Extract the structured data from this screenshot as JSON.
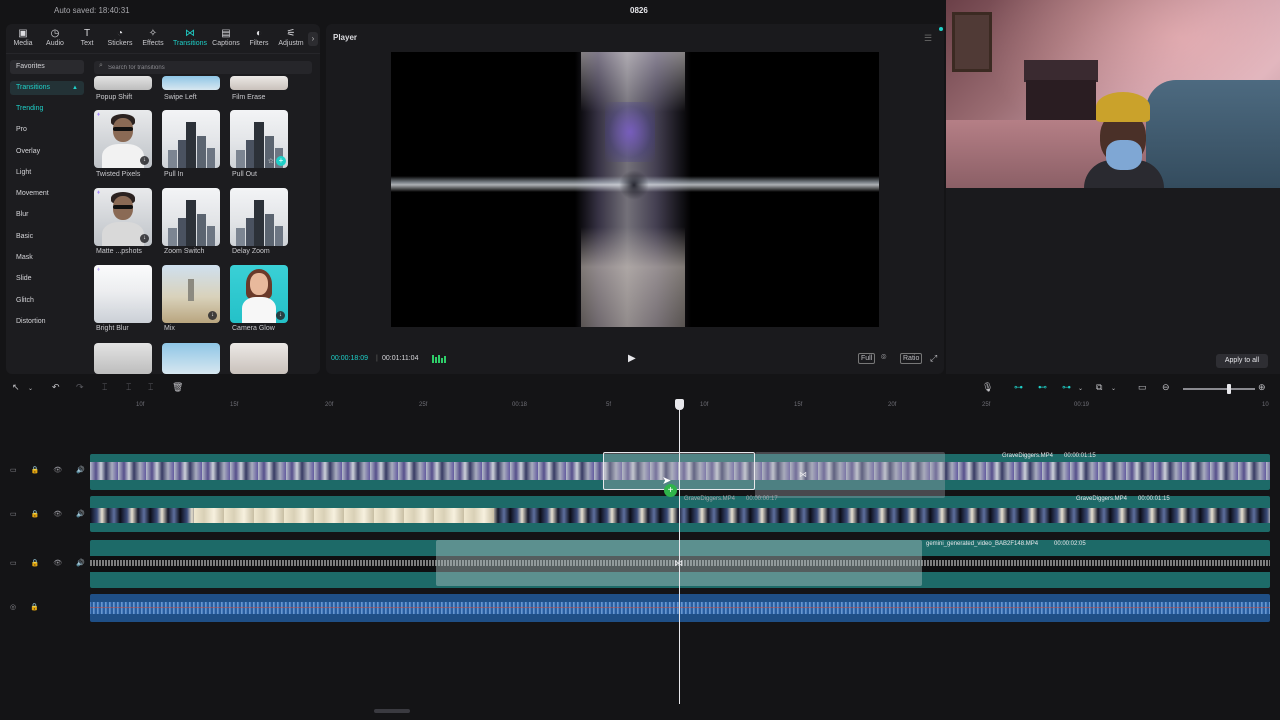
{
  "top_bar": {
    "autosave": "Auto saved: 18:40:31",
    "project_title": "0826"
  },
  "tools": [
    {
      "label": "Media",
      "icon": "media-icon"
    },
    {
      "label": "Audio",
      "icon": "audio-icon"
    },
    {
      "label": "Text",
      "icon": "text-icon"
    },
    {
      "label": "Stickers",
      "icon": "stickers-icon"
    },
    {
      "label": "Effects",
      "icon": "effects-icon"
    },
    {
      "label": "Transitions",
      "icon": "transitions-icon"
    },
    {
      "label": "Captions",
      "icon": "captions-icon"
    },
    {
      "label": "Filters",
      "icon": "filters-icon"
    },
    {
      "label": "Adjustm",
      "icon": "adjustment-icon"
    }
  ],
  "categories": {
    "favorites": "Favorites",
    "transitions": "Transitions",
    "items": [
      "Trending",
      "Pro",
      "Overlay",
      "Light",
      "Movement",
      "Blur",
      "Basic",
      "Mask",
      "Slide",
      "Glitch",
      "Distortion"
    ]
  },
  "search": {
    "placeholder": "Search for transitions"
  },
  "transition_tiles": {
    "row0": [
      "Popup Shift",
      "Swipe Left",
      "Film Erase"
    ],
    "row1": [
      "Twisted Pixels",
      "Pull In",
      "Pull Out"
    ],
    "row2": [
      "Matte ...pshots",
      "Zoom Switch",
      "Delay Zoom"
    ],
    "row3": [
      "Bright Blur",
      "Mix",
      "Camera Glow"
    ]
  },
  "player": {
    "title": "Player",
    "current_time": "00:00:18:09",
    "duration": "00:01:11:04",
    "full_label": "Full",
    "ratio_label": "Ratio"
  },
  "right_panel": {
    "apply_all": "Apply to all"
  },
  "ruler_ticks": [
    "10f",
    "15f",
    "20f",
    "25f",
    "00:18",
    "5f",
    "10f",
    "15f",
    "20f",
    "25f",
    "00:19",
    "10"
  ],
  "clips": {
    "v1_label_name": "GraveDiggers.MP4",
    "v1_label_time": "00:00:01:15",
    "v2_ghost_name": "GraveDiggers.MP4",
    "v2_ghost_time": "00:00:00:17",
    "v2_label_name": "GraveDiggers.MP4",
    "v2_label_time": "00:00:01:15",
    "v3_label_name": "gemini_generated_video_BAB2F148.MP4",
    "v3_label_time": "00:00:02:05"
  },
  "colors": {
    "accent": "#1fd0c8",
    "video_track": "#1d6a68",
    "audio_track": "#1f4f86",
    "add_badge": "#2fb34a"
  }
}
